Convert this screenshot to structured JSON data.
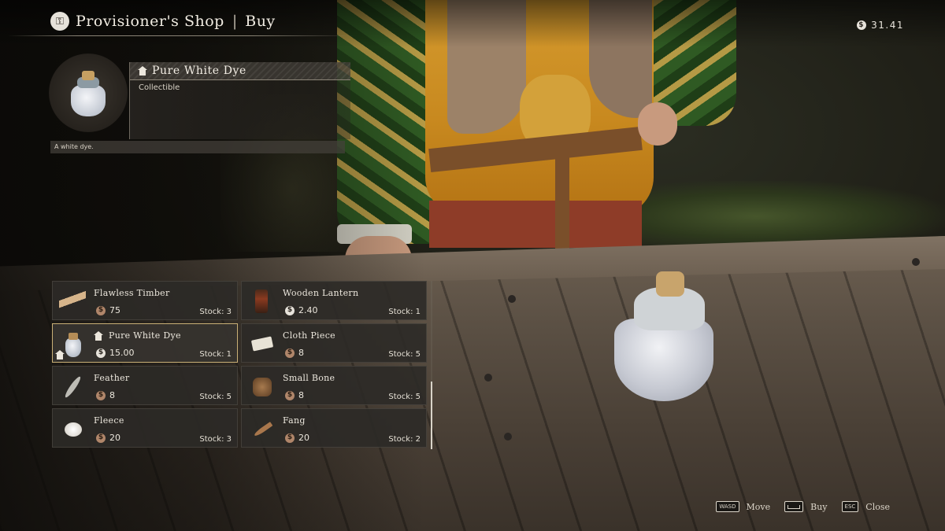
{
  "header": {
    "shop_icon": "money-bag-icon",
    "title": "Provisioner's Shop",
    "separator": "|",
    "mode": "Buy"
  },
  "wallet": {
    "currency_icon": "silver-coin-icon",
    "amount": "31.41"
  },
  "selected_item": {
    "name": "Pure White Dye",
    "category": "Collectible",
    "description": "A white dye.",
    "icon": "house-icon"
  },
  "items": [
    {
      "name": "Flawless Timber",
      "price": "75",
      "coin": "bronze",
      "stock": "Stock: 3",
      "thumb": "timber-icon"
    },
    {
      "name": "Wooden Lantern",
      "price": "2.40",
      "coin": "silver",
      "stock": "Stock: 1",
      "thumb": "lantern-icon"
    },
    {
      "name": "Pure White Dye",
      "price": "15.00",
      "coin": "silver",
      "stock": "Stock: 1",
      "thumb": "dye-icon",
      "selected": true
    },
    {
      "name": "Cloth Piece",
      "price": "8",
      "coin": "bronze",
      "stock": "Stock: 5",
      "thumb": "cloth-icon"
    },
    {
      "name": "Feather",
      "price": "8",
      "coin": "bronze",
      "stock": "Stock: 5",
      "thumb": "feather-icon"
    },
    {
      "name": "Small Bone",
      "price": "8",
      "coin": "bronze",
      "stock": "Stock: 5",
      "thumb": "bone-icon"
    },
    {
      "name": "Fleece",
      "price": "20",
      "coin": "bronze",
      "stock": "Stock: 3",
      "thumb": "fleece-icon"
    },
    {
      "name": "Fang",
      "price": "20",
      "coin": "bronze",
      "stock": "Stock: 2",
      "thumb": "fang-icon"
    }
  ],
  "controls": [
    {
      "key": "WASD",
      "label": "Move"
    },
    {
      "key": "",
      "label": "Buy"
    },
    {
      "key": "ESC",
      "label": "Close"
    }
  ],
  "colors": {
    "selected_border": "#c9b076",
    "panel_bg": "#2c2a27"
  }
}
